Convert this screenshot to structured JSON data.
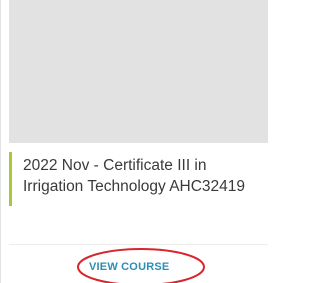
{
  "course_card": {
    "title": "2022 Nov - Certificate III in Irrigation Technology AHC32419",
    "action_label": "VIEW COURSE",
    "accent_color": "#a8c83a",
    "link_color": "#2a8fb3",
    "highlight_color": "#d7262e",
    "image_placeholder_color": "#e2e2e2"
  }
}
